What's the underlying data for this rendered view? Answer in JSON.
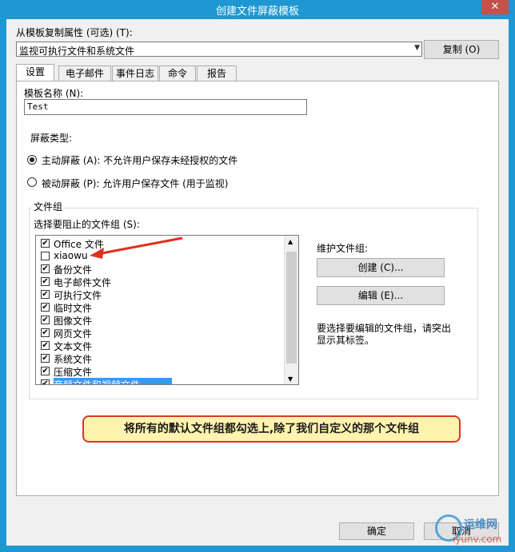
{
  "window": {
    "title": "创建文件屏蔽模板",
    "close": "✕"
  },
  "copy_from": {
    "label": "从模板复制属性 (可选) (T):",
    "value": "监视可执行文件和系统文件",
    "button": "复制 (O)"
  },
  "tabs": [
    "设置",
    "电子邮件",
    "事件日志",
    "命令",
    "报告"
  ],
  "settings": {
    "template_name_label": "模板名称 (N):",
    "template_name_value": "Test",
    "screen_type_label": "屏蔽类型:",
    "active_option": "主动屏蔽 (A): 不允许用户保存未经授权的文件",
    "passive_option": "被动屏蔽 (P): 允许用户保存文件 (用于监视)",
    "file_groups_title": "文件组",
    "select_label": "选择要阻止的文件组 (S):",
    "items": [
      {
        "label": "Office 文件",
        "checked": true
      },
      {
        "label": "xiaowu",
        "checked": false
      },
      {
        "label": "备份文件",
        "checked": true
      },
      {
        "label": "电子邮件文件",
        "checked": true
      },
      {
        "label": "可执行文件",
        "checked": true
      },
      {
        "label": "临时文件",
        "checked": true
      },
      {
        "label": "图像文件",
        "checked": true
      },
      {
        "label": "网页文件",
        "checked": true
      },
      {
        "label": "文本文件",
        "checked": true
      },
      {
        "label": "系统文件",
        "checked": true
      },
      {
        "label": "压缩文件",
        "checked": true
      },
      {
        "label": "音频文件和视频文件",
        "checked": true
      }
    ],
    "maintain_label": "维护文件组:",
    "create_button": "创建 (C)...",
    "edit_button": "编辑 (E)...",
    "hint": "要选择要编辑的文件组，请突出显示其标签。"
  },
  "annotation": "将所有的默认文件组都勾选上,除了我们自定义的那个文件组",
  "footer": {
    "ok": "确定",
    "cancel": "取消"
  },
  "watermark": {
    "top": "运维网",
    "bottom": "iyunv.com"
  },
  "colors": {
    "title_bar": "#1e97d2",
    "arrow": "#e03020",
    "selection": "#3399ff"
  }
}
